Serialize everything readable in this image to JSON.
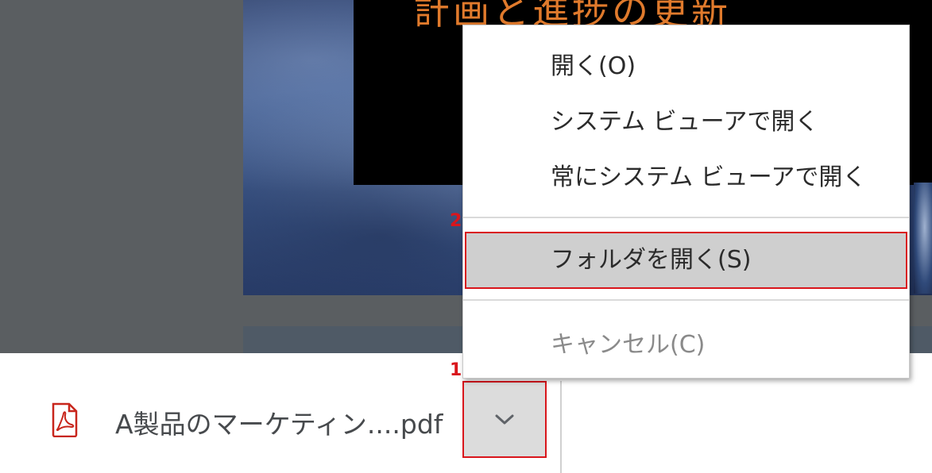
{
  "slide": {
    "title": "計画と進捗の更新"
  },
  "download_bar": {
    "file_name": "A製品のマーケティン....pdf",
    "file_icon": "pdf-icon",
    "options_icon": "chevron-down-icon"
  },
  "context_menu": {
    "items": [
      {
        "label": "開く(O)",
        "enabled": true
      },
      {
        "label": "システム ビューアで開く",
        "enabled": true
      },
      {
        "label": "常にシステム ビューアで開く",
        "enabled": true
      },
      {
        "label": "フォルダを開く(S)",
        "enabled": true,
        "highlighted": true
      },
      {
        "label": "キャンセル(C)",
        "enabled": false
      }
    ]
  },
  "annotations": {
    "step1": "1",
    "step2": "2"
  },
  "colors": {
    "highlight_border": "#d9161c",
    "pdf_red": "#c8261c",
    "menu_hover": "#cfcfcf"
  }
}
